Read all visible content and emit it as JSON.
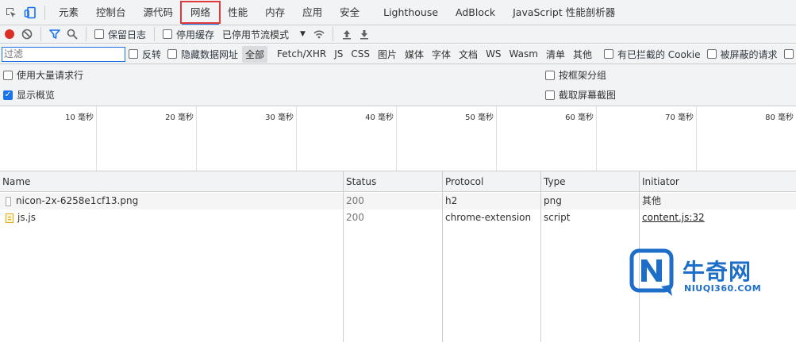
{
  "tabs": [
    "元素",
    "控制台",
    "源代码",
    "网络",
    "性能",
    "内存",
    "应用",
    "安全",
    "Lighthouse",
    "AdBlock",
    "JavaScript 性能剖析器"
  ],
  "toolbar": {
    "preserve_log": "保留日志",
    "disable_cache": "停用缓存",
    "throttling": "已停用节流模式"
  },
  "filter": {
    "placeholder": "过滤",
    "invert": "反转",
    "hide_data_urls": "隐藏数据网址",
    "types": [
      "全部",
      "Fetch/XHR",
      "JS",
      "CSS",
      "图片",
      "媒体",
      "字体",
      "文档",
      "WS",
      "Wasm",
      "清单",
      "其他"
    ],
    "blocked_cookies": "有已拦截的 Cookie",
    "blocked_requests": "被屏蔽的请求"
  },
  "settings": {
    "large_rows": "使用大量请求行",
    "show_overview": "显示概览",
    "group_by_frame": "按框架分组",
    "capture_screenshots": "截取屏幕截图"
  },
  "overview": {
    "ticks": [
      "10 毫秒",
      "20 毫秒",
      "30 毫秒",
      "40 毫秒",
      "50 毫秒",
      "60 毫秒",
      "70 毫秒",
      "80 毫秒"
    ]
  },
  "table": {
    "columns": [
      "Name",
      "Status",
      "Protocol",
      "Type",
      "Initiator"
    ],
    "rows": [
      {
        "name": "nicon-2x-6258e1cf13.png",
        "status": "200",
        "protocol": "h2",
        "type": "png",
        "initiator": "其他"
      },
      {
        "name": "js.js",
        "status": "200",
        "protocol": "chrome-extension",
        "type": "script",
        "initiator": "content.js:32"
      }
    ]
  },
  "watermark": {
    "title": "牛奇网",
    "subtitle": "NIUQI360.COM"
  },
  "colors": {
    "accent": "#1a73e8",
    "record": "#d93025",
    "tab_highlight": "#e03b3b",
    "watermark": "#1d6ec9"
  }
}
